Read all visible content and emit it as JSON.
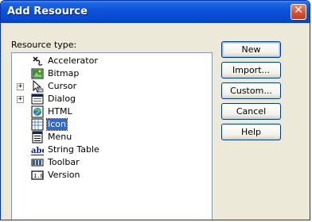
{
  "window": {
    "title": "Add Resource",
    "close_glyph": "✕"
  },
  "resource_type_label": "Resource type:",
  "tree": [
    {
      "label": "Accelerator",
      "icon": "accelerator-icon",
      "expandable": false
    },
    {
      "label": "Bitmap",
      "icon": "bitmap-icon",
      "expandable": false
    },
    {
      "label": "Cursor",
      "icon": "cursor-icon",
      "expandable": true,
      "expander": "+"
    },
    {
      "label": "Dialog",
      "icon": "dialog-icon",
      "expandable": true,
      "expander": "+"
    },
    {
      "label": "HTML",
      "icon": "html-icon",
      "expandable": false
    },
    {
      "label": "Icon",
      "icon": "icon-resource-icon",
      "expandable": false,
      "selected": true
    },
    {
      "label": "Menu",
      "icon": "menu-icon",
      "expandable": false
    },
    {
      "label": "String Table",
      "icon": "string-table-icon",
      "expandable": false
    },
    {
      "label": "Toolbar",
      "icon": "toolbar-icon",
      "expandable": false
    },
    {
      "label": "Version",
      "icon": "version-icon",
      "expandable": false
    }
  ],
  "buttons": {
    "new": "New",
    "import": "Import...",
    "custom": "Custom...",
    "cancel": "Cancel",
    "help": "Help"
  },
  "colors": {
    "titlebar": "#0b52db",
    "selection": "#316ac5",
    "dialog_bg": "#ece9d8"
  }
}
